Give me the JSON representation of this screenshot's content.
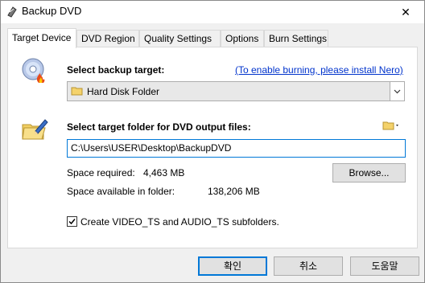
{
  "window": {
    "title": "Backup DVD",
    "close_glyph": "✕"
  },
  "tabs": [
    {
      "label": "Target Device",
      "active": true
    },
    {
      "label": "DVD Region",
      "active": false
    },
    {
      "label": "Quality Settings",
      "active": false
    },
    {
      "label": "Options",
      "active": false
    },
    {
      "label": "Burn Settings",
      "active": false
    }
  ],
  "target": {
    "label": "Select backup target:",
    "nero_link": "(To enable burning, please install Nero)",
    "selected": "Hard Disk Folder",
    "icon": "dvd-burn-icon"
  },
  "output": {
    "label": "Select target folder for DVD output files:",
    "path": "C:\\Users\\USER\\Desktop\\BackupDVD",
    "icon": "folder-pen-icon",
    "browse_label": "Browse...",
    "space_required_label": "Space required:",
    "space_required_value": "4,463 MB",
    "space_available_label": "Space available in folder:",
    "space_available_value": "138,206 MB"
  },
  "subfolders": {
    "label": "Create VIDEO_TS and AUDIO_TS subfolders.",
    "checked": true
  },
  "buttons": {
    "ok": "확인",
    "cancel": "취소",
    "help": "도움말"
  }
}
